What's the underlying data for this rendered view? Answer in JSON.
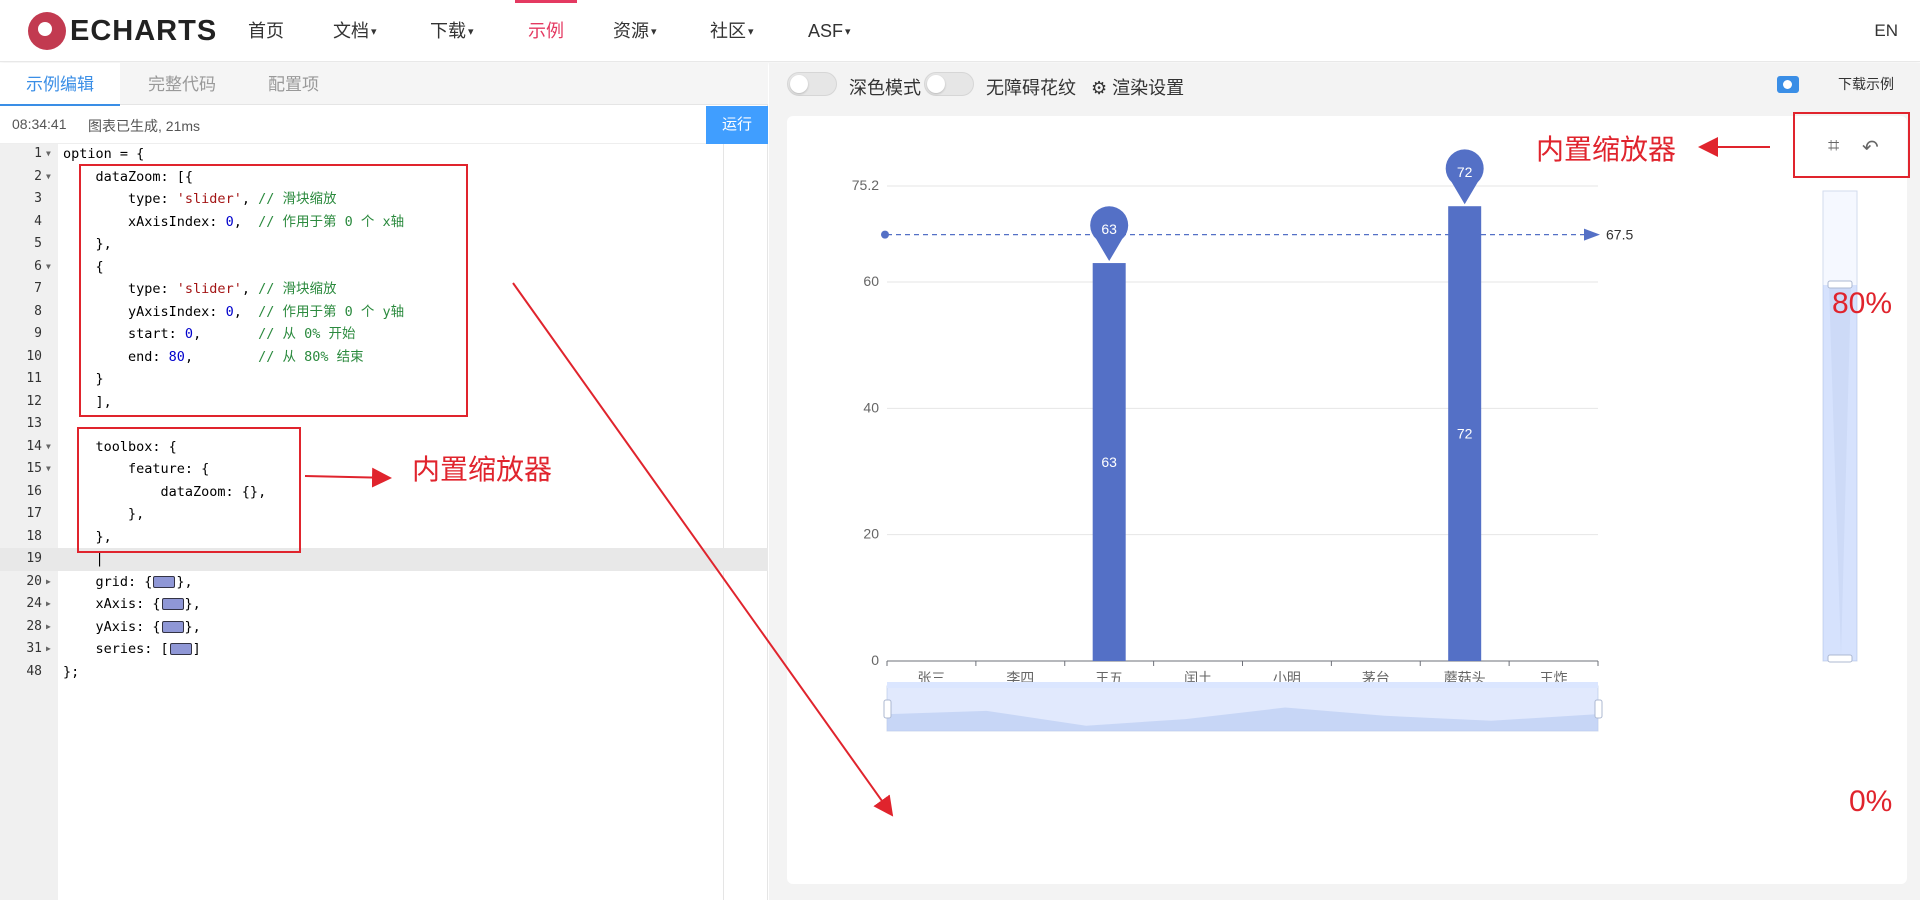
{
  "nav": {
    "logo_text": "ECHARTS",
    "items": [
      {
        "label": "首页"
      },
      {
        "label": "文档",
        "caret": "▾"
      },
      {
        "label": "下载",
        "caret": "▾"
      },
      {
        "label": "示例"
      },
      {
        "label": "资源",
        "caret": "▾"
      },
      {
        "label": "社区",
        "caret": "▾"
      },
      {
        "label": "ASF",
        "caret": "▾"
      }
    ],
    "lang": "EN"
  },
  "editor": {
    "tabs": [
      "示例编辑",
      "完整代码",
      "配置项"
    ],
    "status_time": "08:34:41",
    "status_msg": "图表已生成, 21ms",
    "run_label": "运行",
    "line_numbers": [
      "1",
      "2",
      "3",
      "4",
      "5",
      "6",
      "7",
      "8",
      "9",
      "10",
      "11",
      "12",
      "13",
      "14",
      "15",
      "16",
      "17",
      "18",
      "19",
      "20",
      "24",
      "28",
      "31",
      "48"
    ],
    "lines": [
      "option = {",
      "    dataZoom: [{",
      "        type: 'slider', // 滑块缩放",
      "        xAxisIndex: 0,  // 作用于第 0 个 x轴",
      "    },",
      "    {",
      "        type: 'slider', // 滑块缩放",
      "        yAxisIndex: 0,  // 作用于第 0 个 y轴",
      "        start: 0,       // 从 0% 开始",
      "        end: 80,        // 从 80% 结束",
      "    }",
      "    ],",
      "",
      "    toolbox: {",
      "        feature: {",
      "            dataZoom: {},",
      "        },",
      "    },",
      "",
      "    grid: {",
      "    xAxis: {",
      "    yAxis: {",
      "    series: [",
      "};"
    ]
  },
  "annotations": {
    "code_note": "内置缩放器",
    "chart_note": "内置缩放器",
    "y_end": "80%",
    "y_start": "0%"
  },
  "preview": {
    "dark_mode_label": "深色模式",
    "aria_label": "无障碍花纹",
    "render_label": "渲染设置",
    "download_label": "下载示例"
  },
  "chart_data": {
    "type": "bar",
    "categories": [
      "张三",
      "李四",
      "王五",
      "闰土",
      "小明",
      "茅台",
      "蘑菇头",
      "王炸"
    ],
    "values": [
      0,
      0,
      63,
      0,
      0,
      0,
      72,
      0
    ],
    "ylim": [
      0,
      75.2
    ],
    "yticks": [
      "0",
      "20",
      "40",
      "60",
      "75.2"
    ],
    "mark_points": [
      "63",
      "72"
    ],
    "mark_line": "67.5",
    "bar_color": "#5470c6",
    "grid": true,
    "datazoom_x": "slider",
    "datazoom_y": {
      "type": "slider",
      "start": 0,
      "end": 80
    }
  }
}
